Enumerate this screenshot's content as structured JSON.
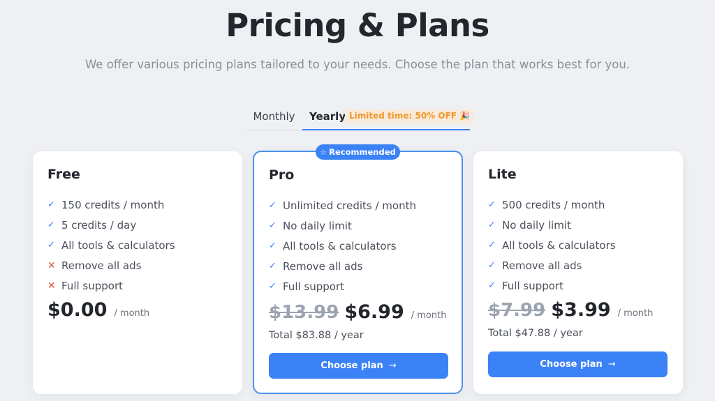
{
  "header": {
    "title": "Pricing & Plans",
    "subtitle": "We offer various pricing plans tailored to your needs. Choose the plan that works best for you."
  },
  "billing_tabs": {
    "monthly_label": "Monthly",
    "yearly_label": "Yearly",
    "selected": "Yearly",
    "promo": "Limited time: 50% OFF 🎉"
  },
  "recommended_badge": "Recommended",
  "plans": [
    {
      "name": "Free",
      "features": [
        {
          "text": "150 credits / month",
          "included": true
        },
        {
          "text": "5 credits / day",
          "included": true
        },
        {
          "text": "All tools & calculators",
          "included": true
        },
        {
          "text": "Remove all ads",
          "included": false
        },
        {
          "text": "Full support",
          "included": false
        }
      ],
      "price": "$0.00",
      "per": "/ month"
    },
    {
      "name": "Pro",
      "features": [
        {
          "text": "Unlimited credits / month",
          "included": true
        },
        {
          "text": "No daily limit",
          "included": true
        },
        {
          "text": "All tools & calculators",
          "included": true
        },
        {
          "text": "Remove all ads",
          "included": true
        },
        {
          "text": "Full support",
          "included": true
        }
      ],
      "old_price": "$13.99",
      "price": "$6.99",
      "per": "/ month",
      "total": "Total $83.88 / year",
      "button": "Choose plan"
    },
    {
      "name": "Lite",
      "features": [
        {
          "text": "500 credits / month",
          "included": true
        },
        {
          "text": "No daily limit",
          "included": true
        },
        {
          "text": "All tools & calculators",
          "included": true
        },
        {
          "text": "Remove all ads",
          "included": true
        },
        {
          "text": "Full support",
          "included": true
        }
      ],
      "old_price": "$7.99",
      "price": "$3.99",
      "per": "/ month",
      "total": "Total $47.88 / year",
      "button": "Choose plan"
    }
  ],
  "icons": {
    "included": "check-icon",
    "excluded": "cross-icon",
    "badge": "star-icon",
    "button": "arrow-right-icon"
  },
  "colors": {
    "accent": "#3b82f6",
    "promo_text": "#f0972b",
    "promo_bg": "#f9ebdb",
    "excluded": "#e0533d",
    "background": "#eef0f4"
  }
}
